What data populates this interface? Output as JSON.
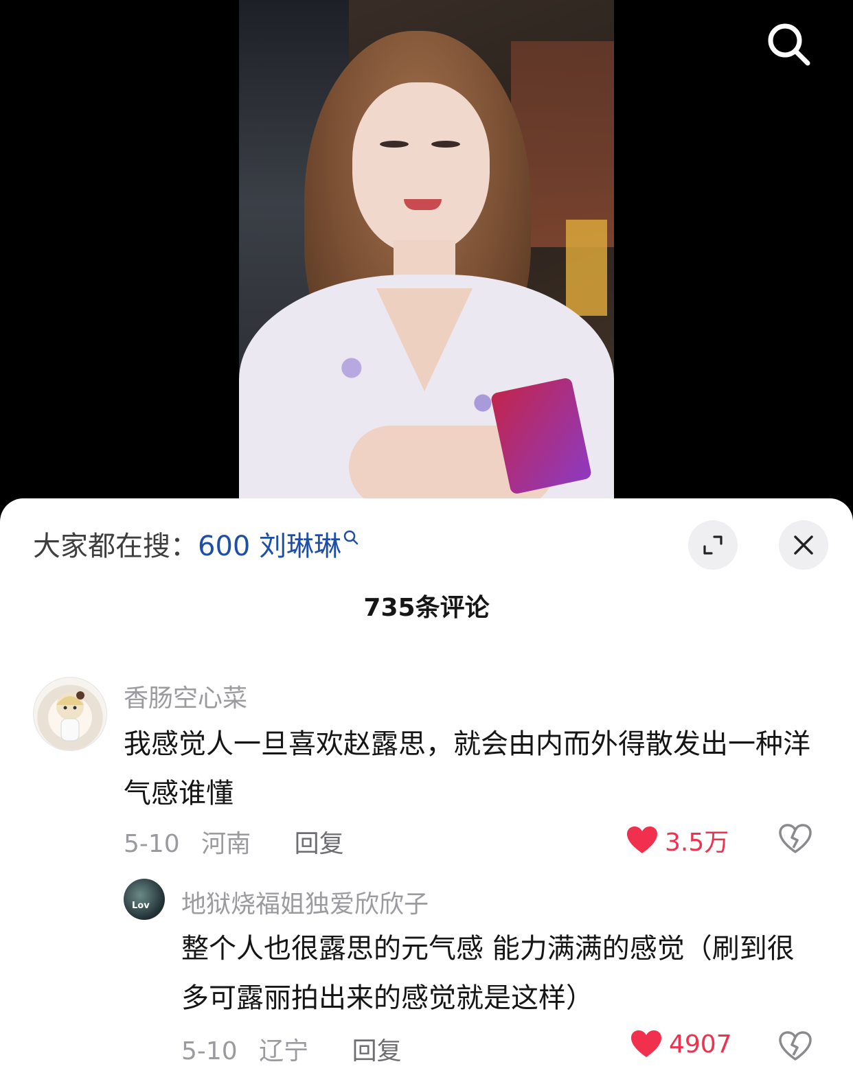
{
  "header": {
    "search_icon": "search-icon"
  },
  "sheet": {
    "search_prefix": "大家都在搜：",
    "search_query": "600 刘琳琳",
    "comment_count": "735条评论",
    "expand_icon": "expand-icon",
    "close_icon": "close-icon",
    "accent_color": "#1e4fa8",
    "like_color": "#f0304d"
  },
  "comments": [
    {
      "username": "香肠空心菜",
      "text": "我感觉人一旦喜欢赵露思，就会由内而外得散发出一种洋气感谁懂",
      "date": "5-10",
      "location": "河南",
      "reply_label": "回复",
      "likes": "3.5万"
    },
    {
      "username": "地狱烧福姐独爱欣欣子",
      "text": "整个人也很露思的元气感 能力满满的感觉（刷到很多可露丽拍出来的感觉就是这样）",
      "date": "5-10",
      "location": "辽宁",
      "reply_label": "回复",
      "likes": "4907",
      "avatar_text": "Lov"
    }
  ]
}
